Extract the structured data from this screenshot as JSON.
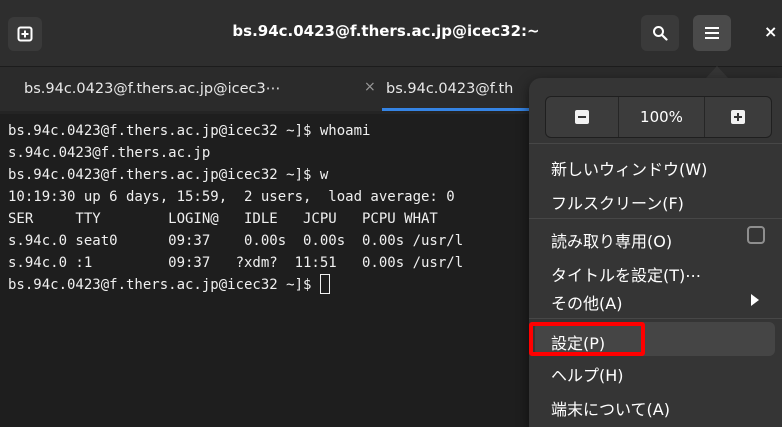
{
  "headerbar": {
    "title": "bs.94c.0423@f.thers.ac.jp@icec32:~",
    "close_label": "×"
  },
  "tabs": [
    {
      "label": "bs.94c.0423@f.thers.ac.jp@icec3⋯",
      "close": "×"
    },
    {
      "label": "bs.94c.0423@f.th"
    }
  ],
  "terminal": {
    "lines": [
      "bs.94c.0423@f.thers.ac.jp@icec32 ~]$ whoami",
      "s.94c.0423@f.thers.ac.jp",
      "bs.94c.0423@f.thers.ac.jp@icec32 ~]$ w",
      "10:19:30 up 6 days, 15:59,  2 users,  load average: 0",
      "SER     TTY        LOGIN@   IDLE   JCPU   PCPU WHAT",
      "s.94c.0 seat0      09:37    0.00s  0.00s  0.00s /usr/l",
      "s.94c.0 :1         09:37   ?xdm?  11:51   0.00s /usr/l",
      "bs.94c.0423@f.thers.ac.jp@icec32 ~]$ "
    ]
  },
  "menu": {
    "zoom_level": "100%",
    "items": {
      "new_window": "新しいウィンドウ(W)",
      "fullscreen": "フルスクリーン(F)",
      "readonly": "読み取り専用(O)",
      "set_title": "タイトルを設定(T)⋯",
      "other": "その他(A)",
      "settings": "設定(P)",
      "help": "ヘルプ(H)",
      "about": "端末について(A)"
    },
    "readonly_checked": false
  },
  "colors": {
    "highlight_box": "#ff0000",
    "tab_indicator": "#3584e4"
  },
  "icons": {
    "new_tab": "new-tab-icon",
    "search": "search-icon",
    "hamburger": "hamburger-menu-icon",
    "zoom_out": "zoom-out-icon",
    "zoom_in": "zoom-in-icon",
    "submenu": "chevron-right-icon"
  }
}
